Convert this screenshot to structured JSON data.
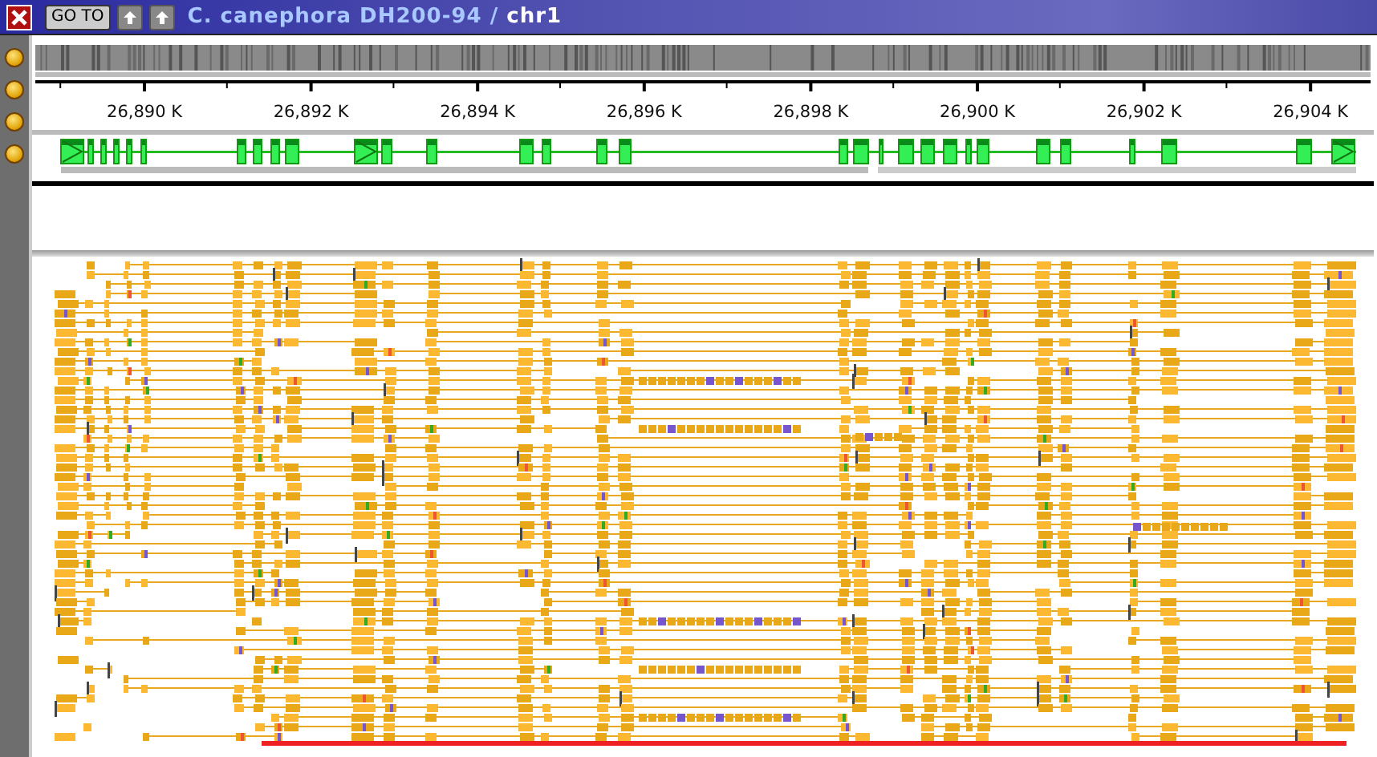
{
  "window": {
    "title": "C. canephora DH200-94 / **chr1**"
  },
  "toolbar": {
    "goto_label": "GO TO"
  },
  "ruler": {
    "labels": [
      "26,890 K",
      "26,892 K",
      "26,894 K",
      "26,896 K",
      "26,898 K",
      "26,900 K",
      "26,902 K",
      "26,904 K"
    ]
  }
}
